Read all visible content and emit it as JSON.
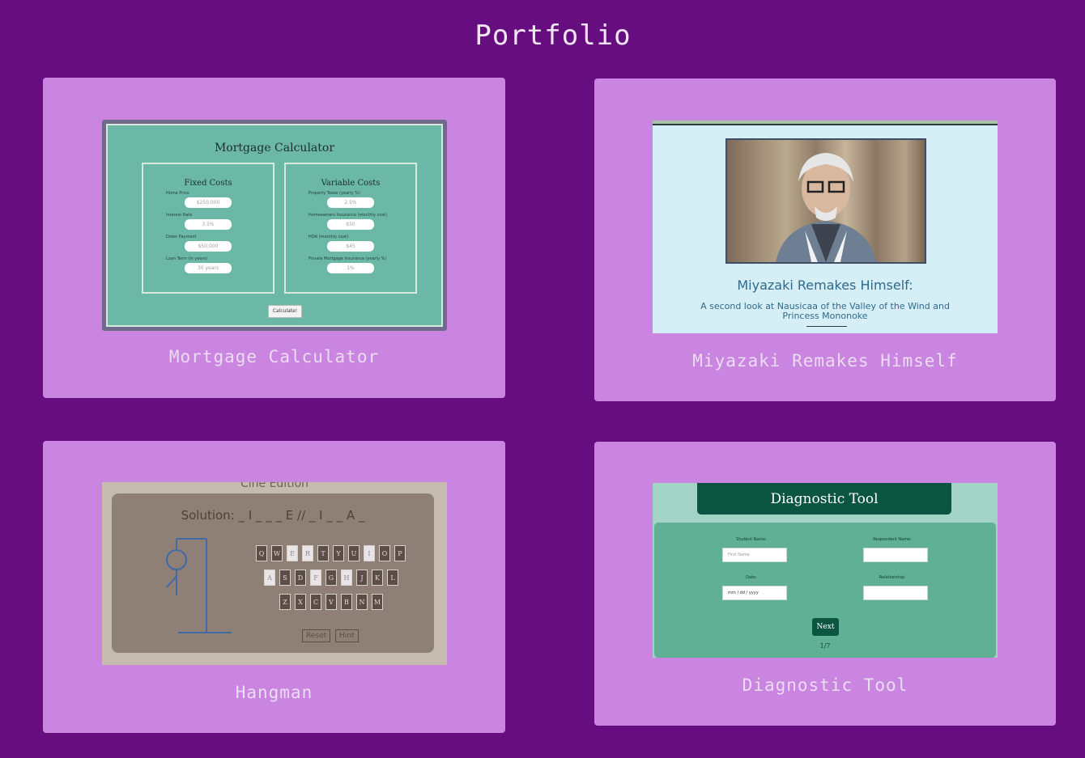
{
  "page": {
    "title": "Portfolio"
  },
  "colors": {
    "background": "#660e80",
    "card": "#c985e0",
    "label": "#ecdcf2"
  },
  "projects": [
    {
      "label": "Mortgage Calculator",
      "preview": {
        "title": "Mortgage Calculator",
        "fixed": {
          "title": "Fixed Costs",
          "fields": [
            {
              "label": "Home Price",
              "value": "$250,000"
            },
            {
              "label": "Interest Rate",
              "value": "3.5%"
            },
            {
              "label": "Down Payment",
              "value": "$50,000"
            },
            {
              "label": "Loan Term (in years)",
              "value": "30 years"
            }
          ]
        },
        "variable": {
          "title": "Variable Costs",
          "fields": [
            {
              "label": "Property Taxes (yearly %)",
              "value": "2.5%"
            },
            {
              "label": "Homeowners Insurance (monthly cost)",
              "value": "$50"
            },
            {
              "label": "HOA (monthly cost)",
              "value": "$45"
            },
            {
              "label": "Private Mortgage Insurance (yearly %)",
              "value": "1%"
            }
          ]
        },
        "button": "Calculate!"
      }
    },
    {
      "label": "Miyazaki Remakes Himself",
      "preview": {
        "title": "Miyazaki Remakes Himself:",
        "subtitle": "A second look at Nausicaa of the Valley of the Wind and Princess Mononoke"
      }
    },
    {
      "label": "Hangman",
      "preview": {
        "edition": "Cine Edition",
        "solution": "Solution: _ I _ _ _ E // _ I _ _ A _",
        "rows": [
          [
            "Q",
            "W",
            "E",
            "R",
            "T",
            "Y",
            "U",
            "I",
            "O",
            "P"
          ],
          [
            "A",
            "S",
            "D",
            "F",
            "G",
            "H",
            "J",
            "K",
            "L"
          ],
          [
            "Z",
            "X",
            "C",
            "V",
            "B",
            "N",
            "M"
          ]
        ],
        "used_letters": [
          "E",
          "R",
          "I",
          "A",
          "F",
          "H"
        ],
        "reset": "Reset",
        "hint": "Hint"
      }
    },
    {
      "label": "Diagnostic Tool",
      "preview": {
        "title": "Diagnostic Tool",
        "student_label": "Student Name:",
        "student_placeholder": "First Name",
        "respondent_label": "Respondent Name:",
        "date_label": "Date:",
        "date_placeholder": "mm / dd / yyyy",
        "relationship_label": "Relationship:",
        "next": "Next",
        "page": "1/7"
      }
    }
  ]
}
